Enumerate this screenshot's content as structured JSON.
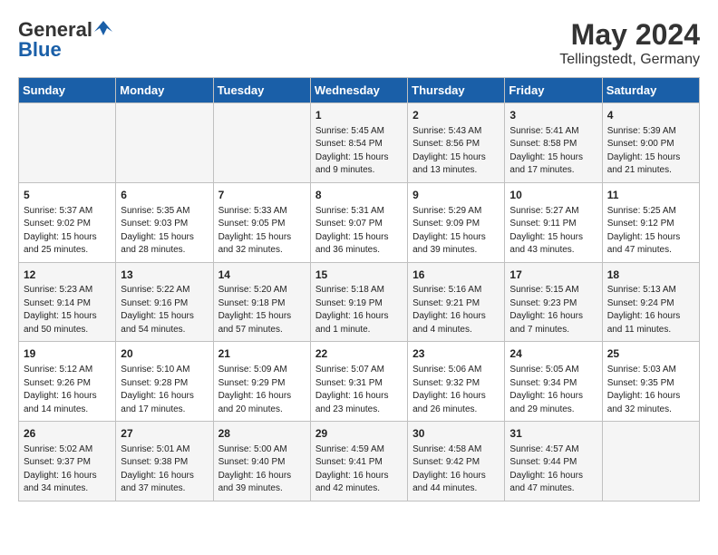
{
  "header": {
    "logo_general": "General",
    "logo_blue": "Blue",
    "month": "May 2024",
    "location": "Tellingstedt, Germany"
  },
  "days_of_week": [
    "Sunday",
    "Monday",
    "Tuesday",
    "Wednesday",
    "Thursday",
    "Friday",
    "Saturday"
  ],
  "weeks": [
    [
      {
        "day": "",
        "content": ""
      },
      {
        "day": "",
        "content": ""
      },
      {
        "day": "",
        "content": ""
      },
      {
        "day": "1",
        "content": "Sunrise: 5:45 AM\nSunset: 8:54 PM\nDaylight: 15 hours\nand 9 minutes."
      },
      {
        "day": "2",
        "content": "Sunrise: 5:43 AM\nSunset: 8:56 PM\nDaylight: 15 hours\nand 13 minutes."
      },
      {
        "day": "3",
        "content": "Sunrise: 5:41 AM\nSunset: 8:58 PM\nDaylight: 15 hours\nand 17 minutes."
      },
      {
        "day": "4",
        "content": "Sunrise: 5:39 AM\nSunset: 9:00 PM\nDaylight: 15 hours\nand 21 minutes."
      }
    ],
    [
      {
        "day": "5",
        "content": "Sunrise: 5:37 AM\nSunset: 9:02 PM\nDaylight: 15 hours\nand 25 minutes."
      },
      {
        "day": "6",
        "content": "Sunrise: 5:35 AM\nSunset: 9:03 PM\nDaylight: 15 hours\nand 28 minutes."
      },
      {
        "day": "7",
        "content": "Sunrise: 5:33 AM\nSunset: 9:05 PM\nDaylight: 15 hours\nand 32 minutes."
      },
      {
        "day": "8",
        "content": "Sunrise: 5:31 AM\nSunset: 9:07 PM\nDaylight: 15 hours\nand 36 minutes."
      },
      {
        "day": "9",
        "content": "Sunrise: 5:29 AM\nSunset: 9:09 PM\nDaylight: 15 hours\nand 39 minutes."
      },
      {
        "day": "10",
        "content": "Sunrise: 5:27 AM\nSunset: 9:11 PM\nDaylight: 15 hours\nand 43 minutes."
      },
      {
        "day": "11",
        "content": "Sunrise: 5:25 AM\nSunset: 9:12 PM\nDaylight: 15 hours\nand 47 minutes."
      }
    ],
    [
      {
        "day": "12",
        "content": "Sunrise: 5:23 AM\nSunset: 9:14 PM\nDaylight: 15 hours\nand 50 minutes."
      },
      {
        "day": "13",
        "content": "Sunrise: 5:22 AM\nSunset: 9:16 PM\nDaylight: 15 hours\nand 54 minutes."
      },
      {
        "day": "14",
        "content": "Sunrise: 5:20 AM\nSunset: 9:18 PM\nDaylight: 15 hours\nand 57 minutes."
      },
      {
        "day": "15",
        "content": "Sunrise: 5:18 AM\nSunset: 9:19 PM\nDaylight: 16 hours\nand 1 minute."
      },
      {
        "day": "16",
        "content": "Sunrise: 5:16 AM\nSunset: 9:21 PM\nDaylight: 16 hours\nand 4 minutes."
      },
      {
        "day": "17",
        "content": "Sunrise: 5:15 AM\nSunset: 9:23 PM\nDaylight: 16 hours\nand 7 minutes."
      },
      {
        "day": "18",
        "content": "Sunrise: 5:13 AM\nSunset: 9:24 PM\nDaylight: 16 hours\nand 11 minutes."
      }
    ],
    [
      {
        "day": "19",
        "content": "Sunrise: 5:12 AM\nSunset: 9:26 PM\nDaylight: 16 hours\nand 14 minutes."
      },
      {
        "day": "20",
        "content": "Sunrise: 5:10 AM\nSunset: 9:28 PM\nDaylight: 16 hours\nand 17 minutes."
      },
      {
        "day": "21",
        "content": "Sunrise: 5:09 AM\nSunset: 9:29 PM\nDaylight: 16 hours\nand 20 minutes."
      },
      {
        "day": "22",
        "content": "Sunrise: 5:07 AM\nSunset: 9:31 PM\nDaylight: 16 hours\nand 23 minutes."
      },
      {
        "day": "23",
        "content": "Sunrise: 5:06 AM\nSunset: 9:32 PM\nDaylight: 16 hours\nand 26 minutes."
      },
      {
        "day": "24",
        "content": "Sunrise: 5:05 AM\nSunset: 9:34 PM\nDaylight: 16 hours\nand 29 minutes."
      },
      {
        "day": "25",
        "content": "Sunrise: 5:03 AM\nSunset: 9:35 PM\nDaylight: 16 hours\nand 32 minutes."
      }
    ],
    [
      {
        "day": "26",
        "content": "Sunrise: 5:02 AM\nSunset: 9:37 PM\nDaylight: 16 hours\nand 34 minutes."
      },
      {
        "day": "27",
        "content": "Sunrise: 5:01 AM\nSunset: 9:38 PM\nDaylight: 16 hours\nand 37 minutes."
      },
      {
        "day": "28",
        "content": "Sunrise: 5:00 AM\nSunset: 9:40 PM\nDaylight: 16 hours\nand 39 minutes."
      },
      {
        "day": "29",
        "content": "Sunrise: 4:59 AM\nSunset: 9:41 PM\nDaylight: 16 hours\nand 42 minutes."
      },
      {
        "day": "30",
        "content": "Sunrise: 4:58 AM\nSunset: 9:42 PM\nDaylight: 16 hours\nand 44 minutes."
      },
      {
        "day": "31",
        "content": "Sunrise: 4:57 AM\nSunset: 9:44 PM\nDaylight: 16 hours\nand 47 minutes."
      },
      {
        "day": "",
        "content": ""
      }
    ]
  ]
}
